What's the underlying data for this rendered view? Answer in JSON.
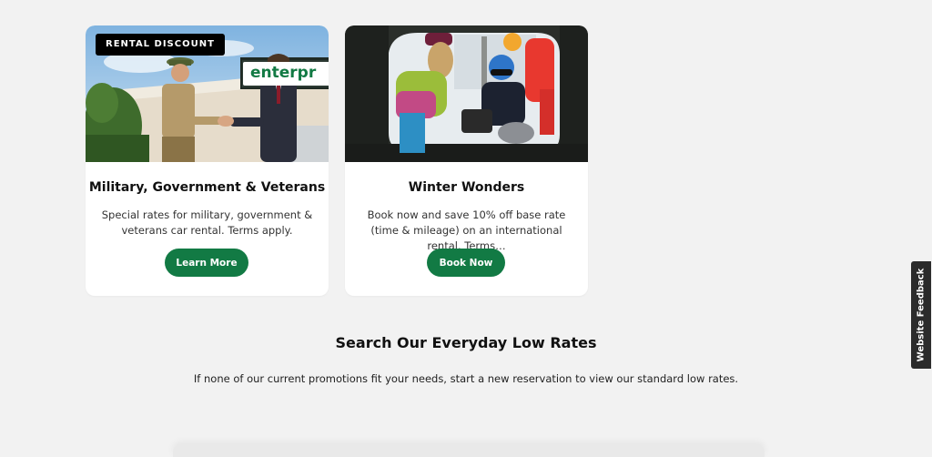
{
  "promotions": [
    {
      "badge": "RENTAL DISCOUNT",
      "title": "Military, Government & Veterans",
      "description": "Special rates for military, government & veterans car rental. Terms apply.",
      "button_label": "Learn More",
      "image_sign_text": "enterpr"
    },
    {
      "title": "Winter Wonders",
      "description": "Book now and save 10% off base rate (time & mileage) on an international rental. Terms…",
      "button_label": "Book Now"
    }
  ],
  "search_section": {
    "title": "Search Our Everyday Low Rates",
    "subtitle": "If none of our current promotions fit your needs, start a new reservation to view our standard low rates."
  },
  "feedback_tab": {
    "label": "Website Feedback"
  },
  "colors": {
    "accent_green": "#127a44",
    "page_bg": "#f2f2f2",
    "card_bg": "#ffffff",
    "badge_bg": "#000000",
    "feedback_bg": "#2b2b2b"
  }
}
